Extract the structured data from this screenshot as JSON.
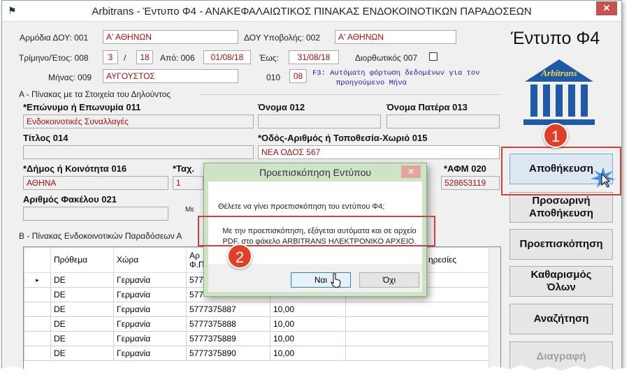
{
  "window": {
    "title": "Arbitrans - Έντυπο Φ4 - ΑΝΑΚΕΦΑΛΑΙΩΤΙΚΟΣ ΠΙΝΑΚΑΣ ΕΝΔΟΚΟΙΝΟΤΙΚΩΝ ΠΑΡΑΔΟΣΕΩΝ",
    "close_glyph": "✕"
  },
  "header": {
    "doy_label": "Αρμόδια ΔΟΥ: 001",
    "doy_value": "Α' ΑΘΗΝΩΝ",
    "doy_sub_label": "ΔΟΥ Υποβολής: 002",
    "doy_sub_value": "Α' ΑΘΗΝΩΝ",
    "quarter_label": "Τρίμηνο/Έτος: 008",
    "quarter_value": "3",
    "slash": "/",
    "year_value": "18",
    "from_label": "Από: 006",
    "from_value": "01/08/18",
    "to_label": "Έως:",
    "to_value": "31/08/18",
    "corrective_label": "Διορθωτικός 007",
    "month_label": "Μήνας: 009",
    "month_value": "ΑΥΓΟΥΣΤΟΣ",
    "code_010_label": "010",
    "code_010_value": "08",
    "hint_line1": "F3: Αυτόματη φόρτωση δεδομένων για τον",
    "hint_line2": "προηγούμενο Μήνα"
  },
  "section_a": {
    "title": "Α - Πίνακας με τα Στοιχεία του Δηλούντος",
    "name_label": "*Επώνυμο ή Επωνυμία 011",
    "name_value": "Ενδοκοινοτικές Συναλλαγές",
    "first_name_label": "Όνομα 012",
    "first_name_value": "",
    "father_label": "Όνομα Πατέρα 013",
    "father_value": "",
    "title_label": "Τίτλος 014",
    "title_value": "",
    "street_label": "*Οδός-Αριθμός ή Τοποθεσία-Χωριό 015",
    "street_value": "ΝΕΑ ΟΔΟΣ 567",
    "municipality_label": "*Δήμος ή Κοινότητα 016",
    "municipality_value": "ΑΘΗΝΑ",
    "postal_label": "*Ταχ.",
    "postal_value": "1",
    "afm_label": "*ΑΦΜ 020",
    "afm_value": "528653119",
    "folder_label": "Αριθμός Φακέλου 021",
    "folder_value": "",
    "partial_label": "Με"
  },
  "section_b": {
    "title": "Β - Πίνακας Ενδοκοινοτικών Παραδόσεων Α",
    "columns": [
      "",
      "Πρόθεμα",
      "Χώρα",
      "Αρ\nΦ.Π",
      "",
      "ηρεσίες"
    ],
    "rows": [
      {
        "marker": "▸",
        "prefix": "DE",
        "country": "Γερμανία",
        "afm": "577",
        "amount": "",
        "services": ""
      },
      {
        "marker": "",
        "prefix": "DE",
        "country": "Γερμανία",
        "afm": "577",
        "amount": "",
        "services": ""
      },
      {
        "marker": "",
        "prefix": "DE",
        "country": "Γερμανία",
        "afm": "5777375887",
        "amount": "10,00",
        "services": ""
      },
      {
        "marker": "",
        "prefix": "DE",
        "country": "Γερμανία",
        "afm": "5777375888",
        "amount": "10,00",
        "services": ""
      },
      {
        "marker": "",
        "prefix": "DE",
        "country": "Γερμανία",
        "afm": "5777375889",
        "amount": "10,00",
        "services": ""
      },
      {
        "marker": "",
        "prefix": "DE",
        "country": "Γερμανία",
        "afm": "5777375890",
        "amount": "10,00",
        "services": ""
      }
    ]
  },
  "sidebar": {
    "form_title": "Έντυπο Φ4",
    "logo_text": "Arbitrans",
    "buttons": {
      "save": "Αποθήκευση",
      "temp_save": "Προσωρινή Αποθήκευση",
      "preview": "Προεπισκόπηση",
      "clear_all": "Καθαρισμός Όλων",
      "search": "Αναζήτηση",
      "delete": "Διαγραφή"
    }
  },
  "dialog": {
    "title": "Προεπισκόπηση Εντύπου",
    "close_glyph": "✕",
    "question": "Θέλετε να γίνει προεπισκόπηση του εντύπου Φ4;",
    "note": "Με την προεπισκόπηση, εξάγεται αυτόματα και σε αρχείο PDF, στο φάκελο ARBITRANS ΗΛΕΚΤΡΟΝΙΚΟ ΑΡΧΕΙΟ.",
    "yes_label": "Ναι",
    "no_label": "Όχι"
  },
  "callouts": {
    "step1": "1",
    "step2": "2",
    "color": "#d04040"
  }
}
